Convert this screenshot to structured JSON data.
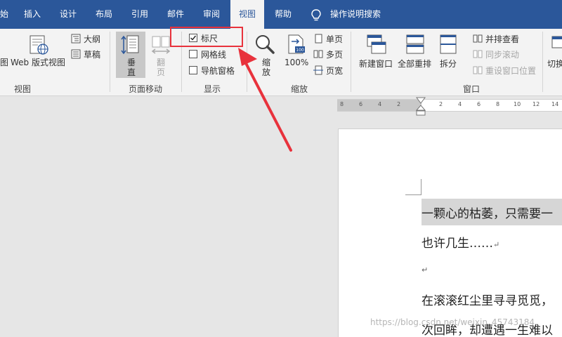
{
  "menubar": {
    "tabs": [
      {
        "label": "始"
      },
      {
        "label": "插入"
      },
      {
        "label": "设计"
      },
      {
        "label": "布局"
      },
      {
        "label": "引用"
      },
      {
        "label": "邮件"
      },
      {
        "label": "审阅"
      },
      {
        "label": "视图"
      },
      {
        "label": "帮助"
      }
    ],
    "tell_me": "操作说明搜索",
    "active_tab": "视图"
  },
  "ribbon": {
    "views": {
      "read_mode_partial": "图",
      "web_layout": "Web 版式视图",
      "outline": "大纲",
      "draft": "草稿",
      "group_label": "视图"
    },
    "page_movement": {
      "vertical": "垂直",
      "side_to_side": "翻页",
      "group_label": "页面移动"
    },
    "show": {
      "ruler": {
        "label": "标尺",
        "checked": true
      },
      "gridlines": {
        "label": "网格线",
        "checked": false
      },
      "navigation_pane": {
        "label": "导航窗格",
        "checked": false
      },
      "group_label": "显示"
    },
    "zoom": {
      "zoom": "缩放",
      "hundred": "100%",
      "one_page": "单页",
      "multiple_pages": "多页",
      "page_width": "页宽",
      "group_label": "缩放"
    },
    "window": {
      "new_window": "新建窗口",
      "arrange_all": "全部重排",
      "split": "拆分",
      "view_side_by_side": "并排查看",
      "synchronous_scrolling": "同步滚动",
      "reset_window_position": "重设窗口位置",
      "group_label": "窗口",
      "switch_partial": "切换"
    }
  },
  "ruler": {
    "ticks": [
      "8",
      "6",
      "4",
      "2",
      "2",
      "4",
      "6",
      "8",
      "10",
      "12",
      "14"
    ]
  },
  "document": {
    "lines": [
      "一颗心的枯萎，只需要一",
      "也许几生……",
      "",
      "在滚滚红尘里寻寻觅觅，",
      "次回眸，却遭遇一生难以"
    ],
    "paragraph_mark": "↵"
  },
  "watermark": "https://blog.csdn.net/weixin_45743184",
  "colors": {
    "accent": "#2b579a",
    "annotation": "#e8323c",
    "ribbon_bg": "#f3f3f3",
    "canvas_bg": "#e6e6e6"
  }
}
